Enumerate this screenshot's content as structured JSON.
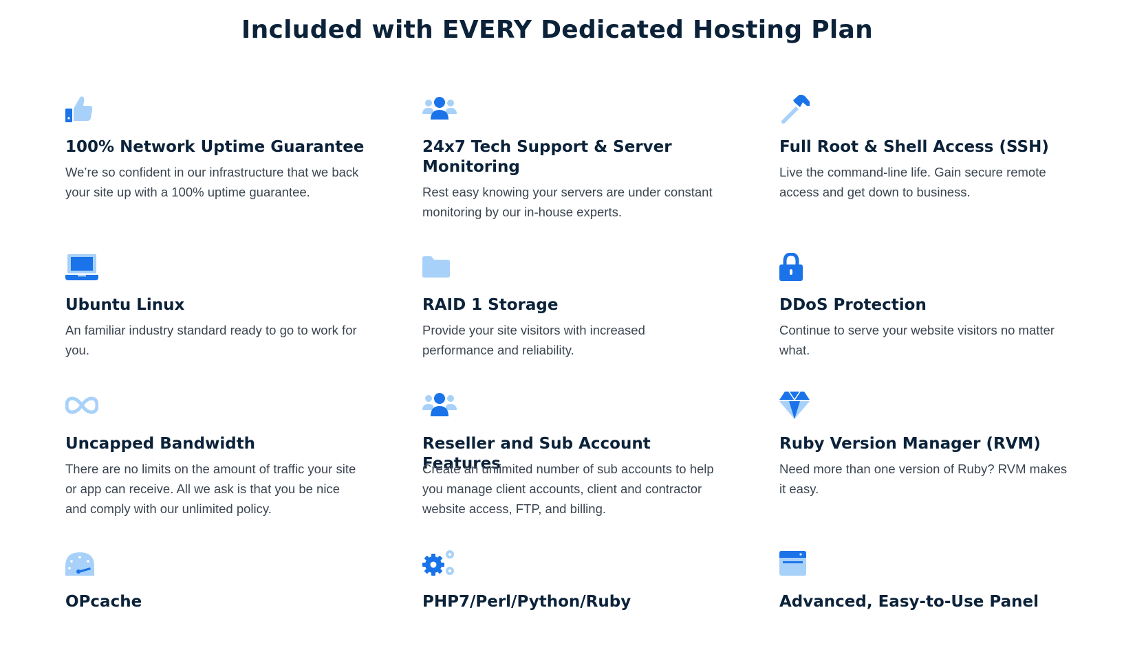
{
  "page": {
    "title": "Included with EVERY Dedicated Hosting Plan"
  },
  "colors": {
    "primary_blue": "#1a73e8",
    "light_blue": "#a8d1fa",
    "heading": "#0b2239",
    "body_text": "#3b4550"
  },
  "features": [
    {
      "icon": "thumbs-up-icon",
      "title": "100% Network Uptime Guarantee",
      "description": "We’re so confident in our infrastructure that we back your site up with a 100% uptime guarantee."
    },
    {
      "icon": "support-team-icon",
      "title": "24x7 Tech Support & Server Monitoring",
      "description": "Rest easy knowing your servers are under constant monitoring by our in-house experts."
    },
    {
      "icon": "hammer-icon",
      "title": "Full Root & Shell Access (SSH)",
      "description": "Live the command-line life. Gain secure remote access and get down to business."
    },
    {
      "icon": "laptop-icon",
      "title": "Ubuntu Linux",
      "description": "An familiar industry standard ready to go to work for you."
    },
    {
      "icon": "folder-icon",
      "title": "RAID 1 Storage",
      "description": "Provide your site visitors with increased performance and reliability."
    },
    {
      "icon": "lock-icon",
      "title": "DDoS Protection",
      "description": "Continue to serve your website visitors no matter what."
    },
    {
      "icon": "infinity-icon",
      "title": "Uncapped Bandwidth",
      "description": "There are no limits on the amount of traffic your site or app can receive. All we ask is that you be nice and comply with our unlimited policy."
    },
    {
      "icon": "users-icon",
      "title": "Reseller and Sub Account Features",
      "description": "Create an unlimited number of sub accounts to help you manage client accounts, client and contractor website access, FTP, and billing."
    },
    {
      "icon": "diamond-icon",
      "title": "Ruby Version Manager (RVM)",
      "description": "Need more than one version of Ruby? RVM makes it easy."
    },
    {
      "icon": "speedometer-icon",
      "title": "OPcache",
      "description": ""
    },
    {
      "icon": "gears-icon",
      "title": "PHP7/Perl/Python/Ruby",
      "description": ""
    },
    {
      "icon": "browser-window-icon",
      "title": "Advanced, Easy-to-Use Panel",
      "description": ""
    }
  ]
}
